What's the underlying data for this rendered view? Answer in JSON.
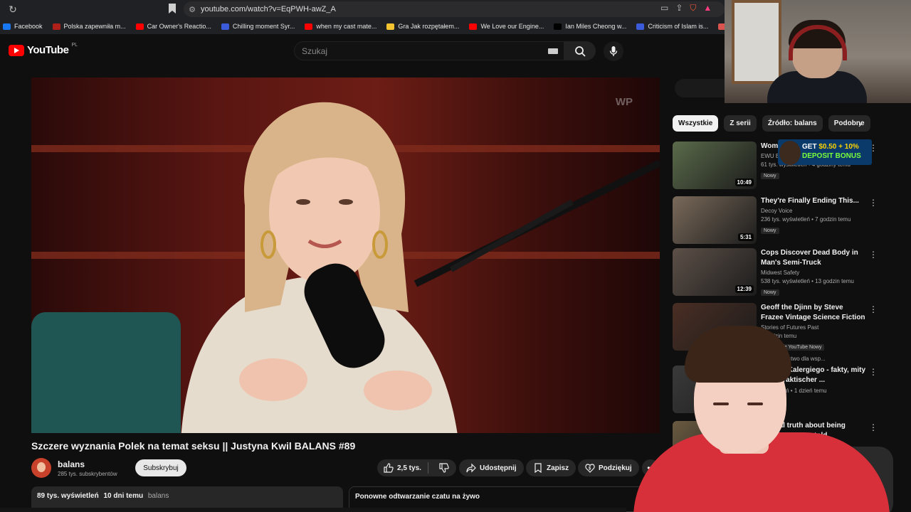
{
  "browser": {
    "url": "youtube.com/watch?v=EqPWH-awZ_A",
    "bookmarks": [
      {
        "label": "Facebook",
        "color": "#1877f2"
      },
      {
        "label": "Polska zapewniła m...",
        "color": "#b0201a"
      },
      {
        "label": "Car Owner's Reactio...",
        "color": "#ff0000"
      },
      {
        "label": "Chilling moment Syr...",
        "color": "#3b5bdb"
      },
      {
        "label": "when my cast mate...",
        "color": "#ff0000"
      },
      {
        "label": "Gra Jak rozpętałem...",
        "color": "#f4c430"
      },
      {
        "label": "We Love our Engine...",
        "color": "#ff0000"
      },
      {
        "label": "Ian Miles Cheong w...",
        "color": "#000000"
      },
      {
        "label": "Criticism of Islam is...",
        "color": "#3b5bdb"
      },
      {
        "label": "In 2012, Nicola F...",
        "color": "#d9534f"
      }
    ]
  },
  "header": {
    "logo_text": "YouTube",
    "region": "PL",
    "search_placeholder": "Szukaj"
  },
  "video": {
    "title": "Szczere wyznania Polek na temat seksu || Justyna Kwil BALANS #89",
    "watermark": "WP",
    "channel": "balans",
    "subscribers": "285 tys. subskrybentów",
    "subscribe_label": "Subskrybuj",
    "likes": "2,5 tys.",
    "share_label": "Udostępnij",
    "save_label": "Zapisz",
    "thanks_label": "Podziękuj",
    "more_label": "•••",
    "views": "89 tys. wyświetleń",
    "age": "10 dni temu",
    "tag": "balans",
    "chat_label": "Ponowne odtwarzanie czatu na żywo"
  },
  "chips": [
    "Wszystkie",
    "Z serii",
    "Źródło: balans",
    "Podobne"
  ],
  "recommendations": [
    {
      "title": "Wom... Insta...",
      "channel": "EWU Bodycam",
      "stats": "61 tys. wyświetleń • 4 godziny temu",
      "badge": "Nowy",
      "duration": "10:49",
      "thumb": "#5a6b4a"
    },
    {
      "title": "They're Finally Ending This...",
      "channel": "Decoy Voice",
      "stats": "236 tys. wyświetleń • 7 godzin temu",
      "badge": "Nowy",
      "duration": "5:31",
      "thumb": "#7a6a5a"
    },
    {
      "title": "Cops Discover Dead Body in Man's Semi-Truck",
      "channel": "Midwest Safety",
      "stats": "538 tys. wyświetleń • 13 godzin temu",
      "badge": "Nowy",
      "duration": "12:39",
      "thumb": "#5d5048"
    },
    {
      "title": "Geoff the Djinn by Steve Frazee Vintage Science Fiction short ...",
      "channel": "Stories of Futures Past",
      "stats": "9 godzin temu",
      "badge": "...ne przez YouTube  Nowy",
      "duration": "",
      "thumb": "#4a2e24"
    },
    {
      "title": "...nifest Kalergiego - fakty, mity ...y z Praktischer ...",
      "channel": "",
      "stats": "...yświetleń • 1 dzień temu",
      "badge": "",
      "duration": "",
      "thumb": "#3a3a3a"
    },
    {
      "title": "...mical truth about being ...what men are told",
      "channel": "",
      "stats": "",
      "badge": "",
      "duration": "",
      "thumb": "#6a5a40"
    }
  ],
  "promo": {
    "line1_prefix": "GET",
    "line1_value": "$0.50 + 10%",
    "line2": "DEPOSIT BONUS"
  },
  "priority_note": "...ierwszeństwo dla wsp..."
}
